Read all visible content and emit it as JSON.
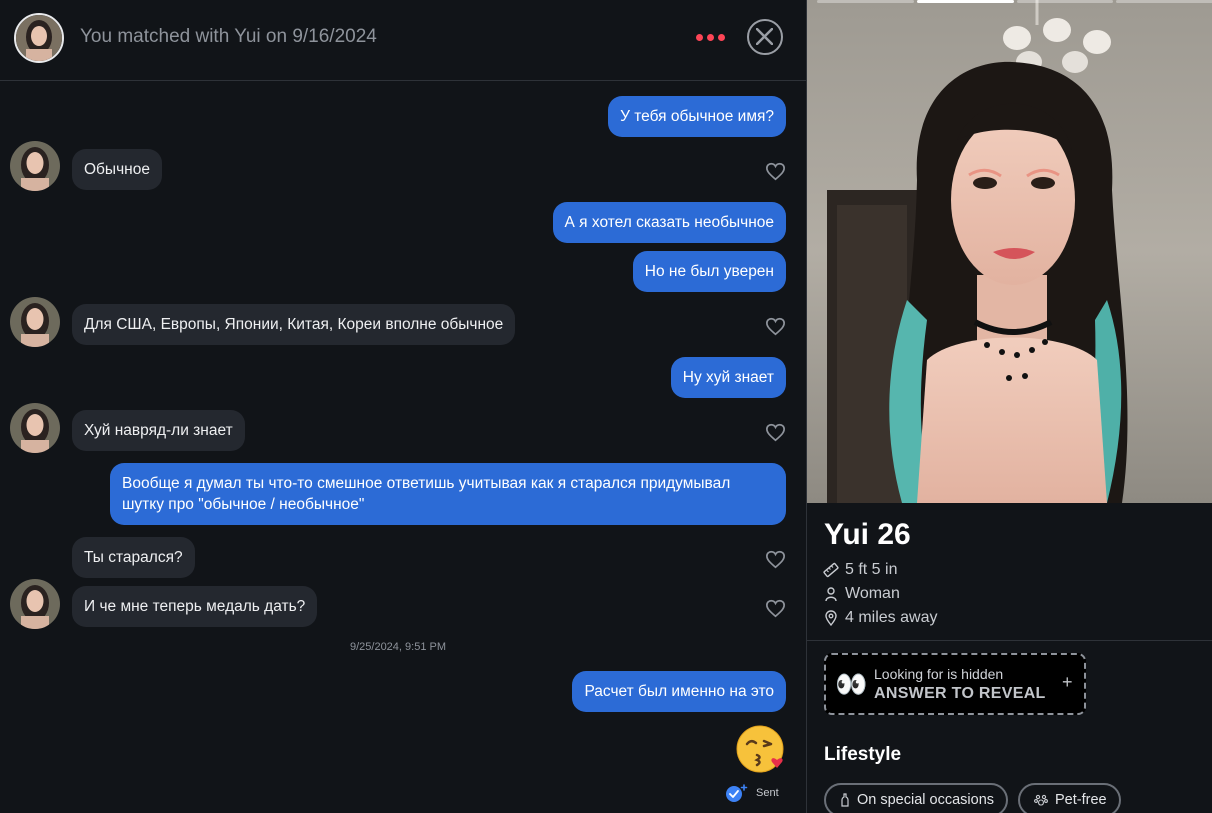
{
  "header": {
    "title": "You matched with Yui on 9/16/2024",
    "more_icon": "more-dots-icon",
    "close_icon": "close-circle-icon",
    "accent_color": "#fd4556"
  },
  "messages": [
    {
      "dir": "out",
      "text": "У тебя обычное имя?"
    },
    {
      "dir": "in",
      "text": "Обычное"
    },
    {
      "dir": "out",
      "text": "А я хотел сказать необычное"
    },
    {
      "dir": "out",
      "text": "Но не был уверен"
    },
    {
      "dir": "in",
      "text": "Для США, Европы, Японии, Китая, Кореи вполне обычное"
    },
    {
      "dir": "out",
      "text": "Ну хуй знает"
    },
    {
      "dir": "in",
      "text": "Хуй навряд-ли знает"
    },
    {
      "dir": "out",
      "text": "Вообще я думал ты что-то смешное ответишь учитывая как я старался придумывал шутку про \"обычное / необычное\""
    },
    {
      "dir": "in",
      "text": "Ты старался?"
    },
    {
      "dir": "in",
      "text": "И че мне теперь медаль дать?"
    },
    {
      "dir": "out",
      "text": "Расчет был именно на это"
    },
    {
      "dir": "out",
      "text": "😘",
      "emoji": "kissing-face-emoji"
    }
  ],
  "timestamp": "9/25/2024, 9:51 PM",
  "status": {
    "label": "Sent",
    "icon": "sent-check-icon",
    "color": "#3d82f5"
  },
  "colors": {
    "outgoing_bubble": "#2c6bd6",
    "incoming_bubble": "#24282f",
    "background": "#111418"
  },
  "profile": {
    "name": "Yui",
    "age": "26",
    "photos_count": 4,
    "active_photo": 2,
    "height": "5 ft 5 in",
    "gender": "Woman",
    "distance": "4 miles away",
    "reveal": {
      "line1": "Looking for is hidden",
      "line2": "ANSWER TO REVEAL",
      "plus": "+",
      "emoji": "👀"
    },
    "lifestyle_title": "Lifestyle",
    "chips": [
      "On special occasions",
      "Pet-free"
    ]
  }
}
